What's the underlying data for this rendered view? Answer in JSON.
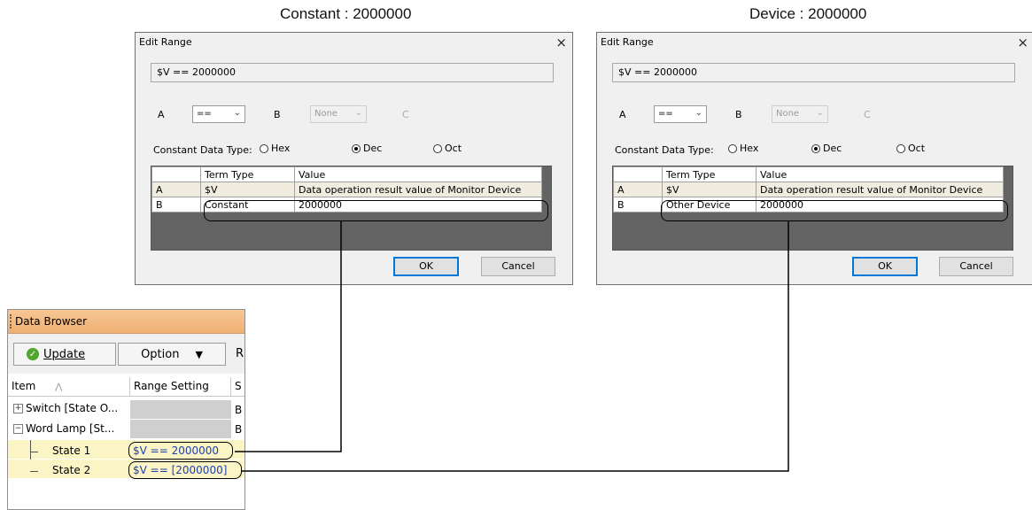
{
  "captions": {
    "left": "Constant : 2000000",
    "right": "Device : 2000000"
  },
  "dialogs": [
    {
      "title": "Edit Range",
      "expression": "$V == 2000000",
      "label_a": "A",
      "combo_a": "==",
      "label_b": "B",
      "combo_b": "None",
      "label_c": "C",
      "data_type_label": "Constant Data Type:",
      "radio_hex": "Hex",
      "radio_dec": "Dec",
      "radio_oct": "Oct",
      "selected_type": "Dec",
      "table_headers": [
        "",
        "Term Type",
        "Value"
      ],
      "row_a": [
        "A",
        "$V",
        "Data operation result value of Monitor Device"
      ],
      "row_b": [
        "B",
        "Constant",
        "2000000"
      ],
      "ok": "OK",
      "cancel": "Cancel",
      "close_icon": "×"
    },
    {
      "title": "Edit Range",
      "expression": "$V == 2000000",
      "label_a": "A",
      "combo_a": "==",
      "label_b": "B",
      "combo_b": "None",
      "label_c": "C",
      "data_type_label": "Constant Data Type:",
      "radio_hex": "Hex",
      "radio_dec": "Dec",
      "radio_oct": "Oct",
      "selected_type": "Dec",
      "table_headers": [
        "",
        "Term Type",
        "Value"
      ],
      "row_a": [
        "A",
        "$V",
        "Data operation result value of Monitor Device"
      ],
      "row_b": [
        "B",
        "Other Device",
        "2000000"
      ],
      "ok": "OK",
      "cancel": "Cancel",
      "close_icon": "×"
    }
  ],
  "data_browser": {
    "title": "Data Browser",
    "update": "Update",
    "option": "Option",
    "cut_label": "R",
    "col_item": "Item",
    "col_range": "Range Setting",
    "col_cut": "S",
    "rows": [
      {
        "item": "Switch [State O...",
        "range": "",
        "cut": "B"
      },
      {
        "item": "Word Lamp [St...",
        "range": "",
        "cut": "B"
      },
      {
        "item": "State 1",
        "range": "$V == 2000000",
        "cut": ""
      },
      {
        "item": "State 2",
        "range": "$V == [2000000]",
        "cut": ""
      }
    ],
    "colors": {
      "title_bar": "#efb072",
      "highlight_row": "#fbf4c4",
      "range_text": "#1e3fb4"
    }
  }
}
